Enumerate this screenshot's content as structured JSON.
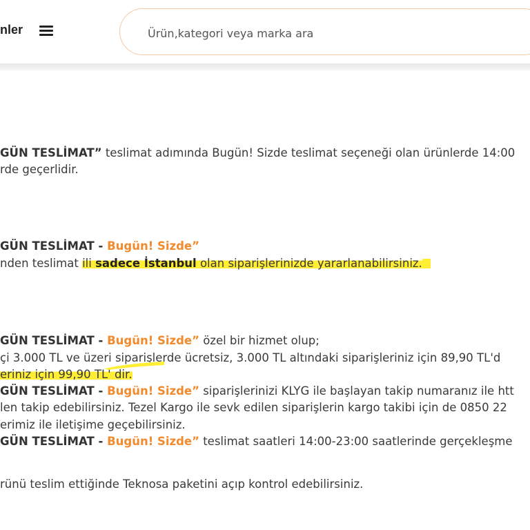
{
  "header": {
    "menu_label": "nler",
    "search_placeholder": "Ürün,kategori veya marka ara"
  },
  "content": {
    "p1": {
      "line1_bold": "GÜN TESLİMAT”",
      "line1_rest": " teslimat adımında Bugün! Sizde teslimat seçeneği olan ürünlerde 14:00",
      "line2": "rde geçerlidir."
    },
    "p2": {
      "line1_bold": "GÜN TESLİMAT - ",
      "line1_orange": "Bugün! Sizde”",
      "line2_pre": "nden teslimat ",
      "line2_hl1": "ili ",
      "line2_hl_bold": "sadece İstanbul",
      "line2_hl2": " olan siparişlerinizde yararlanabilirsiniz."
    },
    "p3": {
      "line1_bold": "GÜN TESLİMAT - ",
      "line1_orange": "Bugün! Sizde”",
      "line1_rest": " özel bir hizmet olup;",
      "line2": "çi 3.000 TL ve üzeri siparişlerde ücretsiz, 3.000 TL altındaki siparişleriniz için 89,90 TL'd",
      "line3_hl": "eriniz için 99,90 TL' dir.",
      "line4_bold": "GÜN TESLİMAT - ",
      "line4_orange": "Bugün! Sizde”",
      "line4_rest": " siparişlerinizi KLYG ile başlayan takip numaranız ile htt",
      "line5": "len takip edebilirsiniz. Tezel Kargo ile sevk edilen siparişlerin kargo takibi için de 0850 22",
      "line6": "erimiz ile iletişime geçebilirsiniz.",
      "line7_bold": "GÜN TESLİMAT - ",
      "line7_orange": "Bugün! Sizde”",
      "line7_rest": " teslimat saatleri 14:00-23:00 saatlerinde gerçekleşme",
      "line8": "rünü teslim ettiğinde Teknosa paketini açıp kontrol edebilirsiniz."
    }
  },
  "colors": {
    "accent": "#f28a2e",
    "highlight": "#ffee33",
    "search_border": "#f3c9a6"
  }
}
